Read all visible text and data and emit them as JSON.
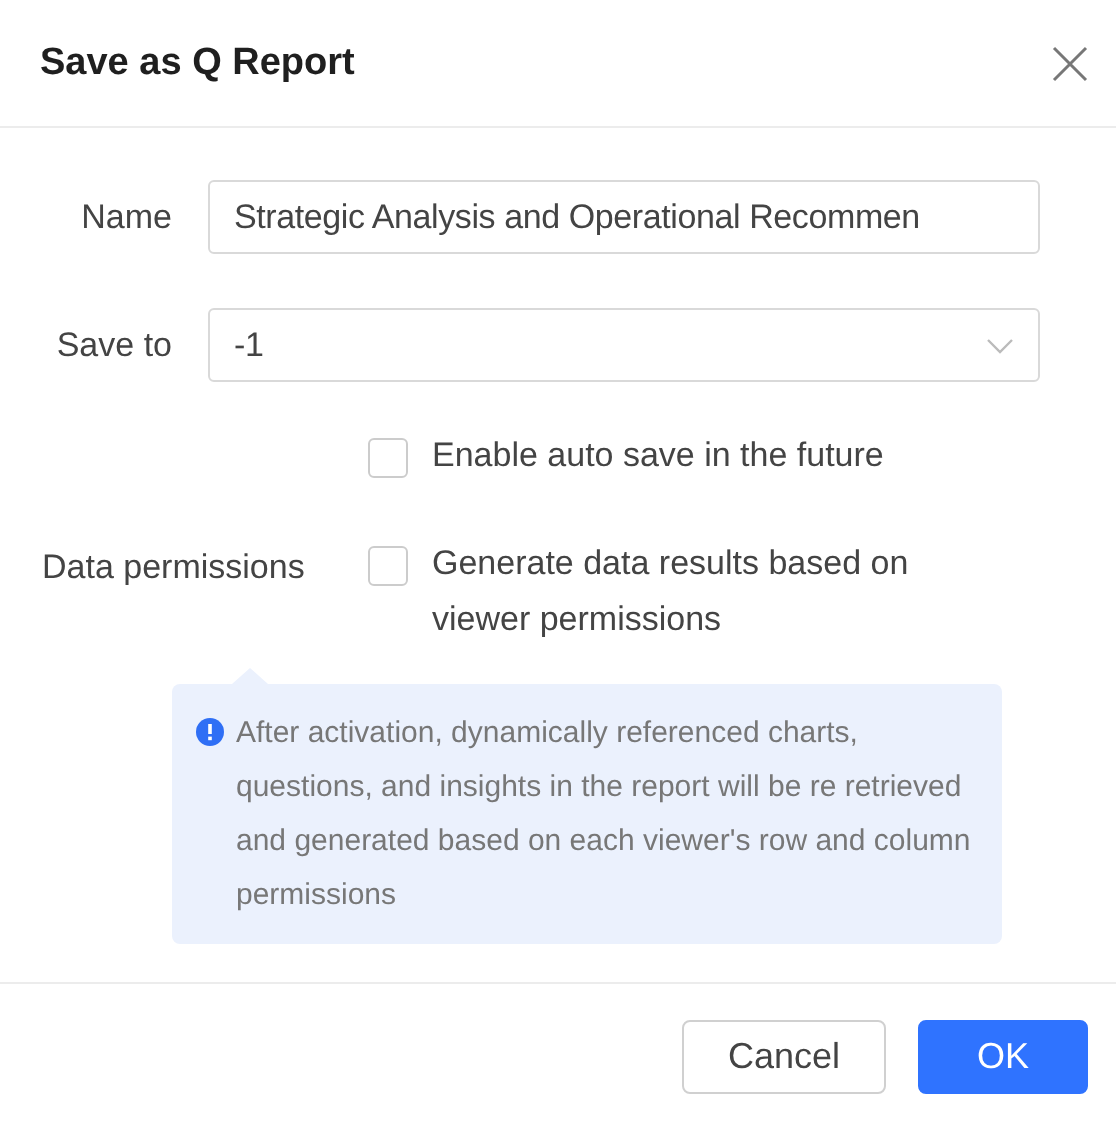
{
  "dialog": {
    "title": "Save as Q Report"
  },
  "fields": [
    {
      "kind": "text",
      "label": "Name",
      "value": "Strategic Analysis and Operational Recommen"
    },
    {
      "kind": "select",
      "label": "Save to",
      "value": "-1"
    }
  ],
  "options": [
    {
      "text": "Enable auto save in the future",
      "checked": false
    },
    {
      "label": "Data permissions",
      "text": "Generate data results based on viewer permissions",
      "checked": false
    }
  ],
  "info": "After activation, dynamically referenced charts, questions, and insights in the report will be re retrieved and generated based on each viewer's row and column permissions",
  "buttons": [
    {
      "kind": "secondary",
      "label": "Cancel"
    },
    {
      "kind": "primary",
      "label": "OK"
    }
  ]
}
